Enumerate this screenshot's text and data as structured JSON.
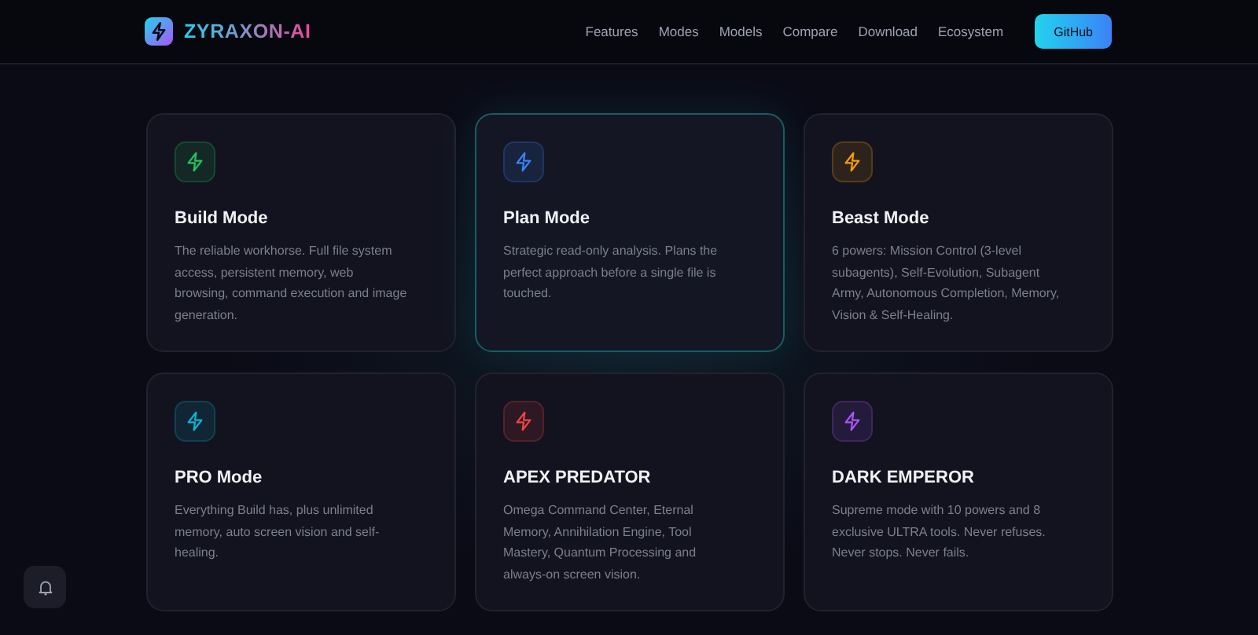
{
  "header": {
    "logo": "ZYRAXON-AI",
    "nav": [
      "Features",
      "Modes",
      "Models",
      "Compare",
      "Download",
      "Ecosystem"
    ],
    "cta": "GitHub"
  },
  "modes": [
    {
      "title": "Build Mode",
      "description": "The reliable workhorse. Full file system access, persistent memory, web browsing, command execution and image generation.",
      "color": "#22c55e",
      "selected": false
    },
    {
      "title": "Plan Mode",
      "description": "Strategic read-only analysis. Plans the perfect approach before a single file is touched.",
      "color": "#3b82f6",
      "selected": true
    },
    {
      "title": "Beast Mode",
      "description": "6 powers: Mission Control (3-level subagents), Self-Evolution, Subagent Army, Autonomous Completion, Memory, Vision & Self-Healing.",
      "color": "#f59e0b",
      "selected": false
    },
    {
      "title": "PRO Mode",
      "description": "Everything Build has, plus unlimited memory, auto screen vision and self-healing.",
      "color": "#06b6d4",
      "selected": false
    },
    {
      "title": "APEX PREDATOR",
      "description": "Omega Command Center, Eternal Memory, Annihilation Engine, Tool Mastery, Quantum Processing and always-on screen vision.",
      "color": "#ef4444",
      "selected": false
    },
    {
      "title": "DARK EMPEROR",
      "description": "Supreme mode with 10 powers and 8 exclusive ULTRA tools. Never refuses. Never stops. Never fails.",
      "color": "#a855f7",
      "selected": false
    }
  ]
}
